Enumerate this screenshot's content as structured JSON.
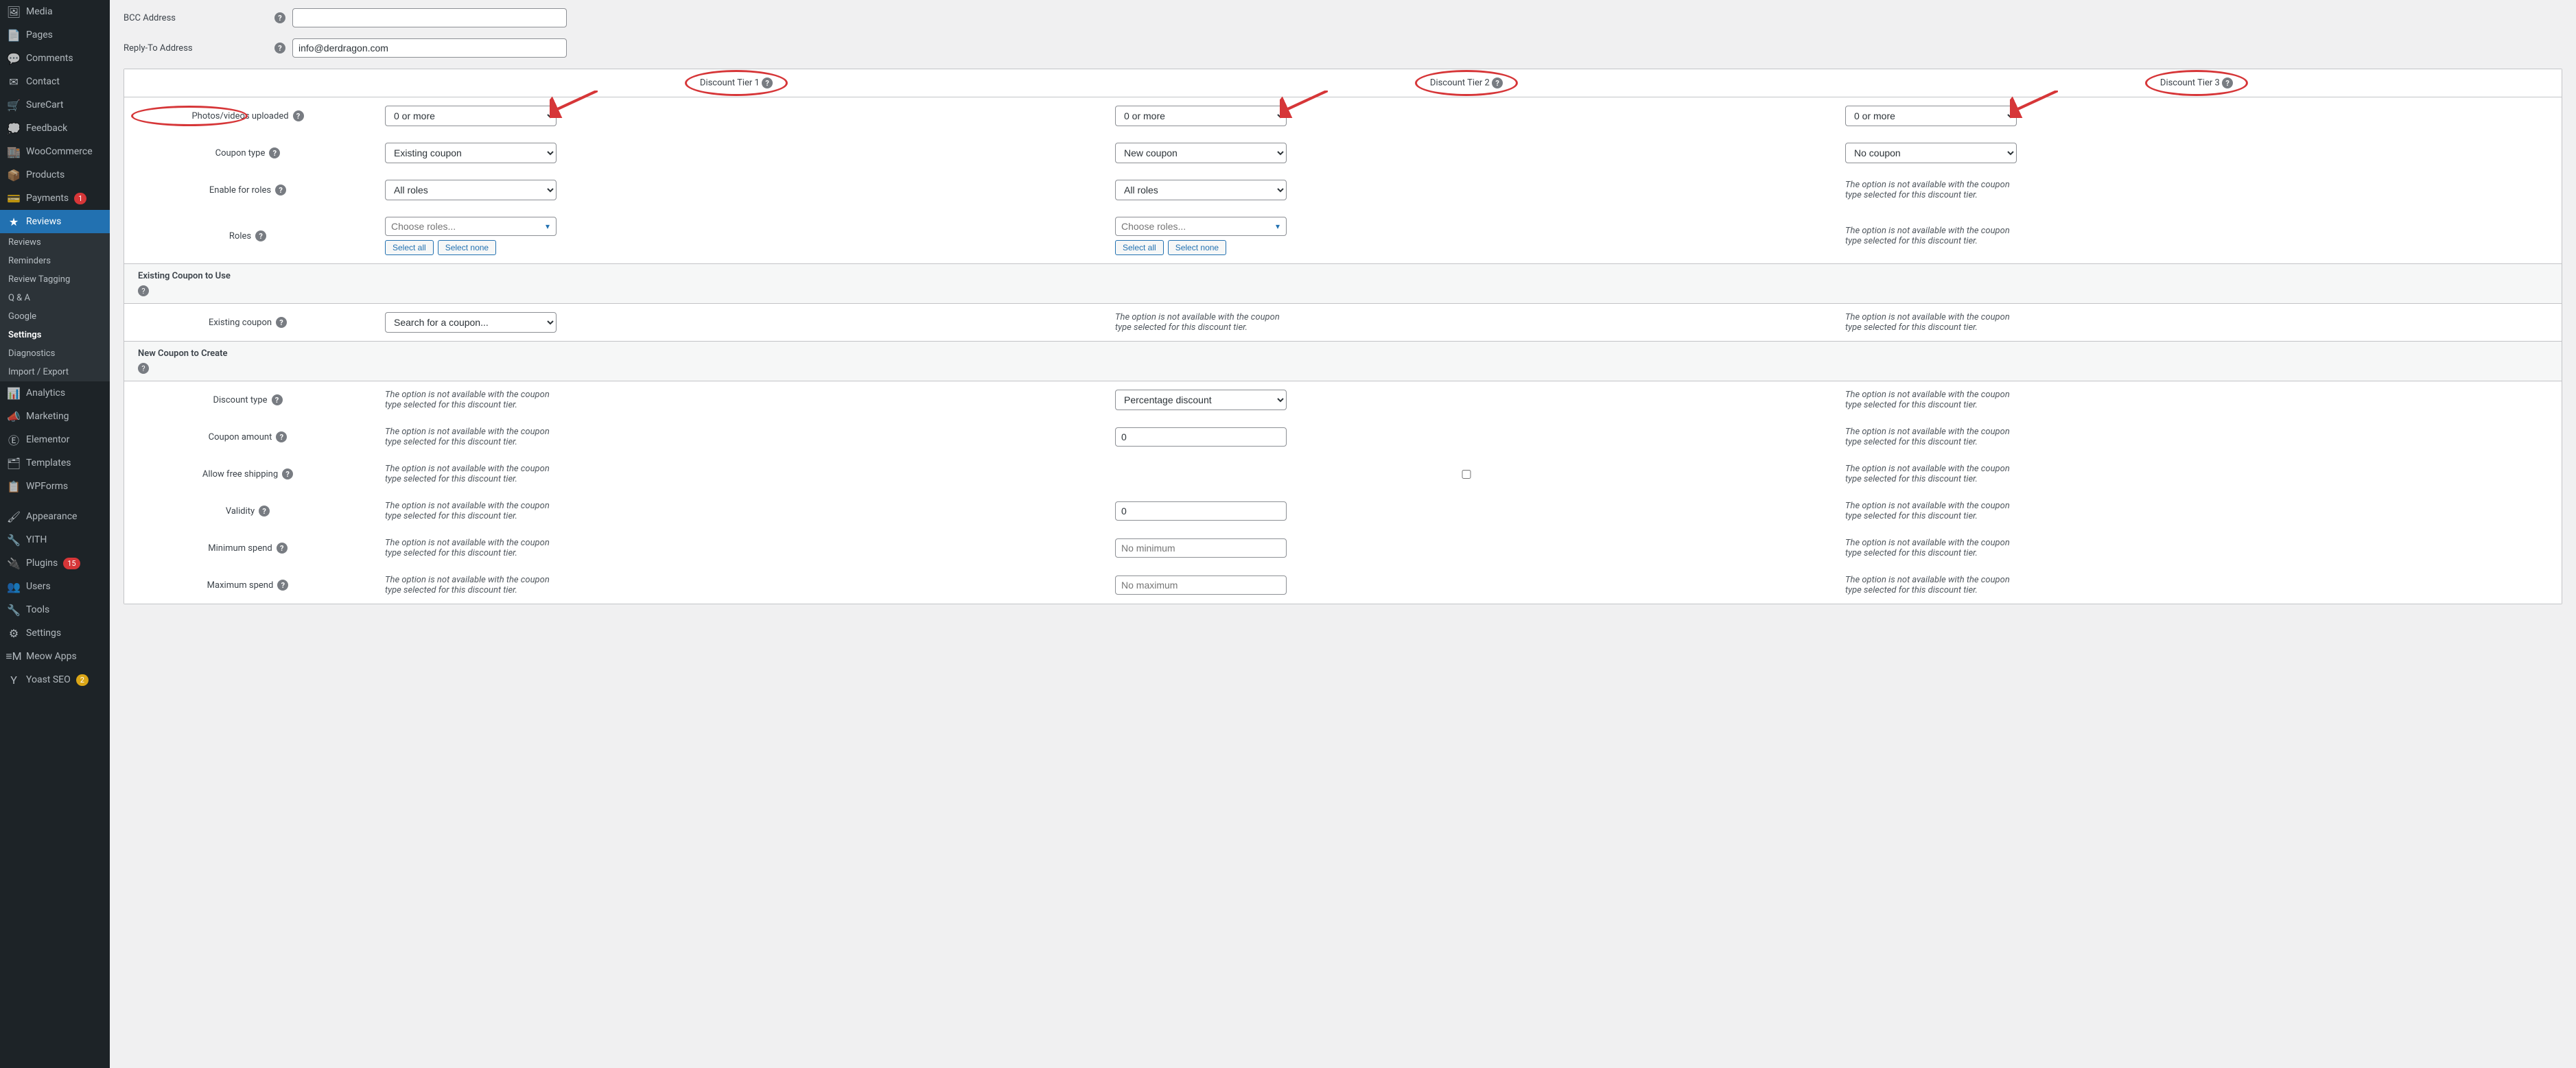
{
  "sidebar": {
    "items": [
      {
        "label": "Media",
        "icon": "🖼"
      },
      {
        "label": "Pages",
        "icon": "📄"
      },
      {
        "label": "Comments",
        "icon": "💬"
      },
      {
        "label": "Contact",
        "icon": "✉"
      },
      {
        "label": "SureCart",
        "icon": "🛒"
      },
      {
        "label": "Feedback",
        "icon": "💭"
      },
      {
        "label": "WooCommerce",
        "icon": "🏬"
      },
      {
        "label": "Products",
        "icon": "📦"
      },
      {
        "label": "Payments",
        "icon": "💳",
        "badge": "1"
      },
      {
        "label": "Reviews",
        "icon": "★",
        "active": true
      },
      {
        "label": "Analytics",
        "icon": "📊"
      },
      {
        "label": "Marketing",
        "icon": "📣"
      },
      {
        "label": "Elementor",
        "icon": "Ⓔ"
      },
      {
        "label": "Templates",
        "icon": "🗂"
      },
      {
        "label": "WPForms",
        "icon": "📋"
      },
      {
        "label": "Appearance",
        "icon": "🖌"
      },
      {
        "label": "YITH",
        "icon": "🔧"
      },
      {
        "label": "Plugins",
        "icon": "🔌",
        "badge": "15"
      },
      {
        "label": "Users",
        "icon": "👥"
      },
      {
        "label": "Tools",
        "icon": "🔧"
      },
      {
        "label": "Settings",
        "icon": "⚙"
      },
      {
        "label": "Meow Apps",
        "icon": "≡M"
      },
      {
        "label": "Yoast SEO",
        "icon": "Y",
        "badge_orange": "2"
      }
    ],
    "subitems": [
      "Reviews",
      "Reminders",
      "Review Tagging",
      "Q & A",
      "Google",
      "Settings",
      "Diagnostics",
      "Import / Export"
    ],
    "sub_active": "Settings"
  },
  "email": {
    "bcc_label": "BCC Address",
    "bcc_value": "",
    "replyto_label": "Reply-To Address",
    "replyto_value": "info@derdragon.com"
  },
  "tiers": {
    "headers": [
      "Discount Tier 1",
      "Discount Tier 2",
      "Discount Tier 3"
    ],
    "unavail": "The option is not available with the coupon type selected for this discount tier.",
    "rows": {
      "photos": {
        "label": "Photos/videos uploaded",
        "t1": "0 or more",
        "t2": "0 or more",
        "t3": "0 or more"
      },
      "coupon_type": {
        "label": "Coupon type",
        "t1": "Existing coupon",
        "t2": "New coupon",
        "t3": "No coupon"
      },
      "enable_roles": {
        "label": "Enable for roles",
        "t1": "All roles",
        "t2": "All roles"
      },
      "roles": {
        "label": "Roles",
        "placeholder": "Choose roles...",
        "select_all": "Select all",
        "select_none": "Select none"
      },
      "existing_section": "Existing Coupon to Use",
      "existing_coupon": {
        "label": "Existing coupon",
        "placeholder": "Search for a coupon..."
      },
      "new_section": "New Coupon to Create",
      "discount_type": {
        "label": "Discount type",
        "t2": "Percentage discount"
      },
      "coupon_amount": {
        "label": "Coupon amount",
        "t2": "0"
      },
      "free_ship": {
        "label": "Allow free shipping"
      },
      "validity": {
        "label": "Validity",
        "t2": "0"
      },
      "min_spend": {
        "label": "Minimum spend",
        "t2": "No minimum"
      },
      "max_spend": {
        "label": "Maximum spend",
        "t2": "No maximum"
      }
    }
  }
}
